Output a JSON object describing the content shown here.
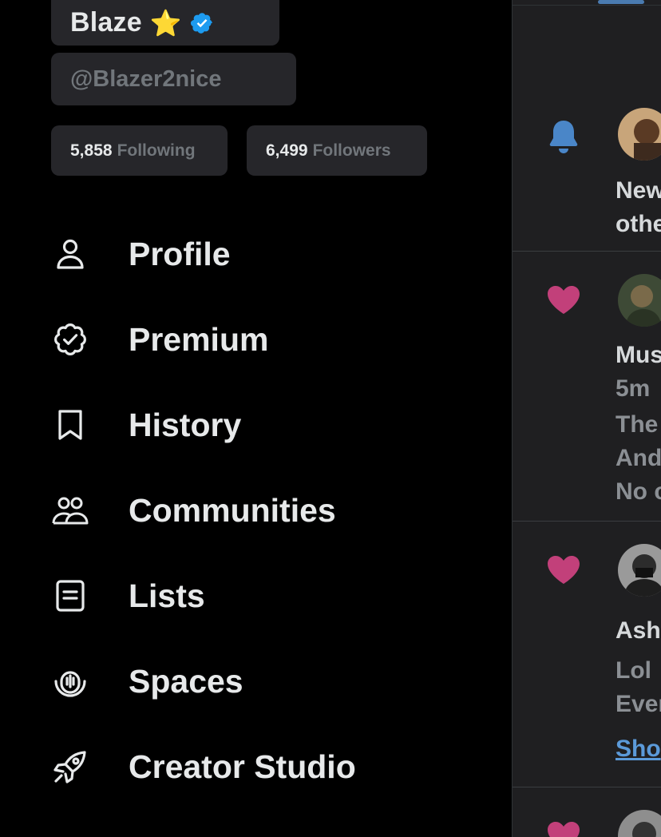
{
  "profile": {
    "display_name": "Blaze",
    "name_emoji": "⭐",
    "handle": "@Blazer2nice",
    "following_count": "5,858",
    "following_label": "Following",
    "followers_count": "6,499",
    "followers_label": "Followers"
  },
  "menu": {
    "items": [
      {
        "label": "Profile",
        "icon": "person-icon"
      },
      {
        "label": "Premium",
        "icon": "verified-badge-icon"
      },
      {
        "label": "History",
        "icon": "bookmark-icon"
      },
      {
        "label": "Communities",
        "icon": "communities-icon"
      },
      {
        "label": "Lists",
        "icon": "list-icon"
      },
      {
        "label": "Spaces",
        "icon": "spaces-icon"
      },
      {
        "label": "Creator Studio",
        "icon": "rocket-icon"
      }
    ]
  },
  "notifications": [
    {
      "type": "bell",
      "lines": [
        "New",
        "othe"
      ]
    },
    {
      "type": "like",
      "lines": [
        "Mus",
        "5m",
        "The",
        "And",
        "No c"
      ]
    },
    {
      "type": "like",
      "lines": [
        "Ash",
        "Lol",
        "Ever",
        "Sho"
      ]
    },
    {
      "type": "like",
      "lines": []
    }
  ],
  "colors": {
    "background": "#000000",
    "chip": "#26262a",
    "text": "#e7e9ea",
    "muted": "#71767b",
    "verified_blue": "#1d9bf0",
    "bell_blue": "#4a86c8",
    "heart_pink": "#c2407a"
  }
}
